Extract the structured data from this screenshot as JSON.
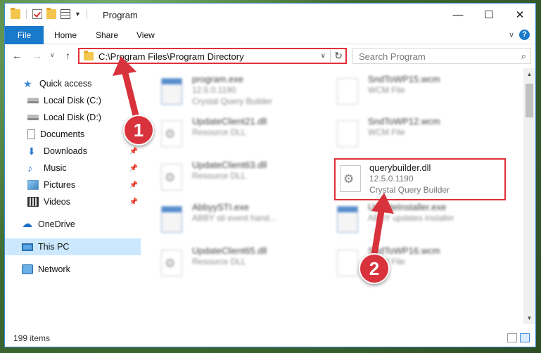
{
  "window": {
    "title": "Program",
    "controls": {
      "minimize": "—",
      "maximize": "☐",
      "close": "✕"
    }
  },
  "ribbon": {
    "tabs": [
      "File",
      "Home",
      "Share",
      "View"
    ],
    "help": "?"
  },
  "nav": {
    "address_path": "C:\\Program Files\\Program Directory",
    "search_placeholder": "Search Program"
  },
  "sidebar": {
    "items": [
      {
        "label": "Quick access",
        "icon": "star-icon"
      },
      {
        "label": "Local Disk (C:)",
        "icon": "disk-icon"
      },
      {
        "label": "Local Disk (D:)",
        "icon": "disk-icon"
      },
      {
        "label": "Documents",
        "icon": "documents-icon"
      },
      {
        "label": "Downloads",
        "icon": "download-icon"
      },
      {
        "label": "Music",
        "icon": "music-icon"
      },
      {
        "label": "Pictures",
        "icon": "pictures-icon"
      },
      {
        "label": "Videos",
        "icon": "videos-icon"
      },
      {
        "label": "OneDrive",
        "icon": "cloud-icon"
      },
      {
        "label": "This PC",
        "icon": "computer-icon"
      },
      {
        "label": "Network",
        "icon": "network-icon"
      }
    ]
  },
  "files": [
    {
      "name": "program.exe",
      "line2": "12.5.0.1190",
      "line3": "Crystal Query Builder",
      "icon": "exe-file-icon"
    },
    {
      "name": "SndToWP15.wcm",
      "line2": "WCM File",
      "line3": "",
      "icon": "blank-file-icon"
    },
    {
      "name": "UpdateClient21.dll",
      "line2": "Resource DLL",
      "line3": "",
      "icon": "dll-file-icon"
    },
    {
      "name": "SndToWP12.wcm",
      "line2": "WCM File",
      "line3": "",
      "icon": "blank-file-icon"
    },
    {
      "name": "UpdateClient63.dll",
      "line2": "Resource DLL",
      "line3": "",
      "icon": "dll-file-icon"
    },
    {
      "name": "querybuilder.dll",
      "line2": "12.5.0.1190",
      "line3": "Crystal Query Builder",
      "icon": "dll-file-icon"
    },
    {
      "name": "AbbyySTI.exe",
      "line2": "ABBY sti event hand...",
      "line3": "",
      "icon": "exe-file-icon"
    },
    {
      "name": "UpdateInstaller.exe",
      "line2": "ABBY updates installer",
      "line3": "",
      "icon": "exe-file-icon"
    },
    {
      "name": "UpdateClient65.dll",
      "line2": "Resource DLL",
      "line3": "",
      "icon": "dll-file-icon"
    },
    {
      "name": "SndToWP16.wcm",
      "line2": "WCM File",
      "line3": "",
      "icon": "blank-file-icon"
    }
  ],
  "status": {
    "item_count": "199 items"
  },
  "annotations": {
    "step1": "1",
    "step2": "2"
  },
  "colors": {
    "accent": "#1979ca",
    "highlight": "#e0303a",
    "badge": "#d8323c",
    "selected": "#cce8ff"
  }
}
